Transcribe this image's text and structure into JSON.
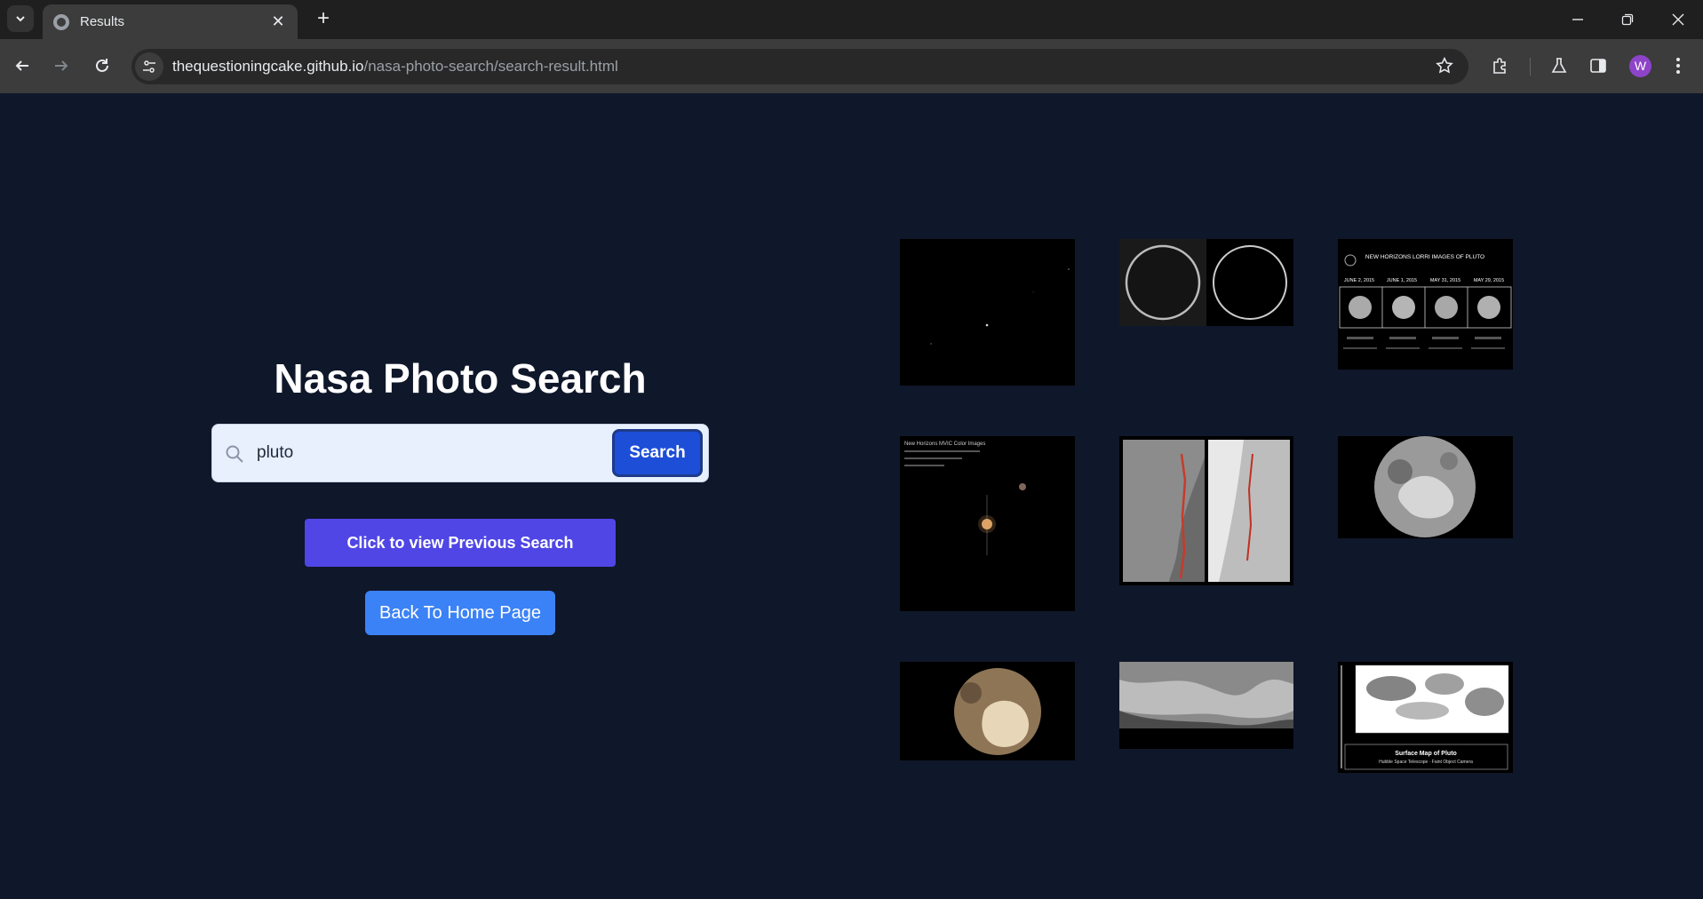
{
  "browser": {
    "tab_title": "Results",
    "url_host": "thequestioningcake.github.io",
    "url_path": "/nasa-photo-search/search-result.html",
    "profile_initial": "W"
  },
  "page": {
    "title": "Nasa Photo Search",
    "search": {
      "value": "pluto",
      "button_label": "Search"
    },
    "previous_search_label": "Click to view Previous Search",
    "home_label": "Back To Home Page",
    "colors": {
      "background": "#0f172a",
      "search_button": "#1d4ed8",
      "previous_button": "#4f46e5",
      "home_button": "#3b82f6"
    }
  },
  "results": {
    "image_text": {
      "lorri_title": "NEW HORIZONS LORRI IMAGES OF PLUTO",
      "lorri_dates": [
        "JUNE 2, 2015",
        "JUNE 1, 2015",
        "MAY 31, 2015",
        "MAY 29, 2015"
      ],
      "mvic_title": "New Horizons MVIC Color Images",
      "map_title": "Surface Map of Pluto",
      "map_subtitle": "Hubble Space Telescope · Faint Object Camera"
    }
  }
}
